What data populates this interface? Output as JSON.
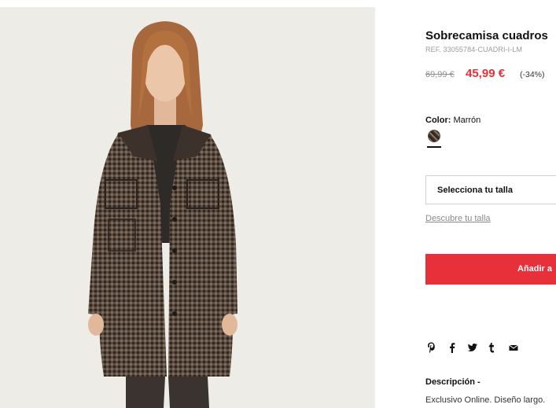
{
  "product": {
    "title": "Sobrecamisa cuadros",
    "ref": "REF. 33055784-CUADRI-I-LM",
    "old_price": "69,99 €",
    "price": "45,99 €",
    "discount": "(-34%)"
  },
  "color": {
    "label": "Color:",
    "value": "Marrón"
  },
  "size": {
    "select_label": "Selecciona tu talla",
    "guide_link": "Descubre tu talla"
  },
  "cart": {
    "add_label": "Añadir a"
  },
  "share": {
    "icons": [
      "pinterest-icon",
      "facebook-icon",
      "twitter-icon",
      "tumblr-icon",
      "email-icon"
    ]
  },
  "description": {
    "title": "Descripción -",
    "text": "Exclusivo Online. Diseño largo."
  },
  "colors": {
    "accent": "#e8303a",
    "photo_bg": "#eeece6",
    "coat": "#4d4038"
  }
}
